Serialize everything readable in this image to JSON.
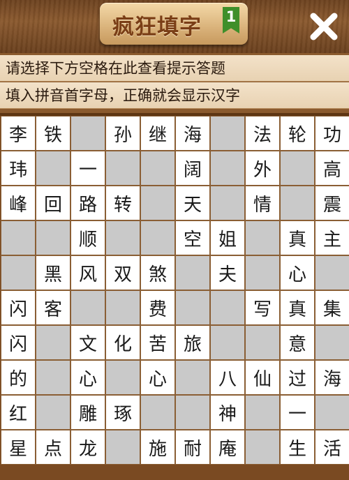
{
  "header": {
    "title": "疯狂填字",
    "level": "1"
  },
  "hints": {
    "line1": "请选择下方空格在此查看提示答题",
    "line2": "填入拼音首字母，正确就会显示汉字"
  },
  "grid": [
    [
      "李",
      "铁",
      "#",
      "孙",
      "继",
      "海",
      "#",
      "法",
      "轮",
      "功"
    ],
    [
      "玮",
      "#",
      "一",
      "#",
      "#",
      "阔",
      "#",
      "外",
      "#",
      "高"
    ],
    [
      "峰",
      "回",
      "路",
      "转",
      "#",
      "天",
      "#",
      "情",
      "#",
      "震"
    ],
    [
      "#",
      "#",
      "顺",
      "#",
      "#",
      "空",
      "姐",
      "#",
      "真",
      "主"
    ],
    [
      "#",
      "黑",
      "风",
      "双",
      "煞",
      "#",
      "夫",
      "#",
      "心",
      "#"
    ],
    [
      "闪",
      "客",
      "#",
      "#",
      "费",
      "#",
      "#",
      "写",
      "真",
      "集"
    ],
    [
      "闪",
      "#",
      "文",
      "化",
      "苦",
      "旅",
      "#",
      "#",
      "意",
      "#"
    ],
    [
      "的",
      "#",
      "心",
      "#",
      "心",
      "#",
      "八",
      "仙",
      "过",
      "海"
    ],
    [
      "红",
      "#",
      "雕",
      "琢",
      "#",
      "#",
      "神",
      "#",
      "一",
      "#"
    ],
    [
      "星",
      "点",
      "龙",
      "#",
      "施",
      "耐",
      "庵",
      "#",
      "生",
      "活"
    ]
  ]
}
